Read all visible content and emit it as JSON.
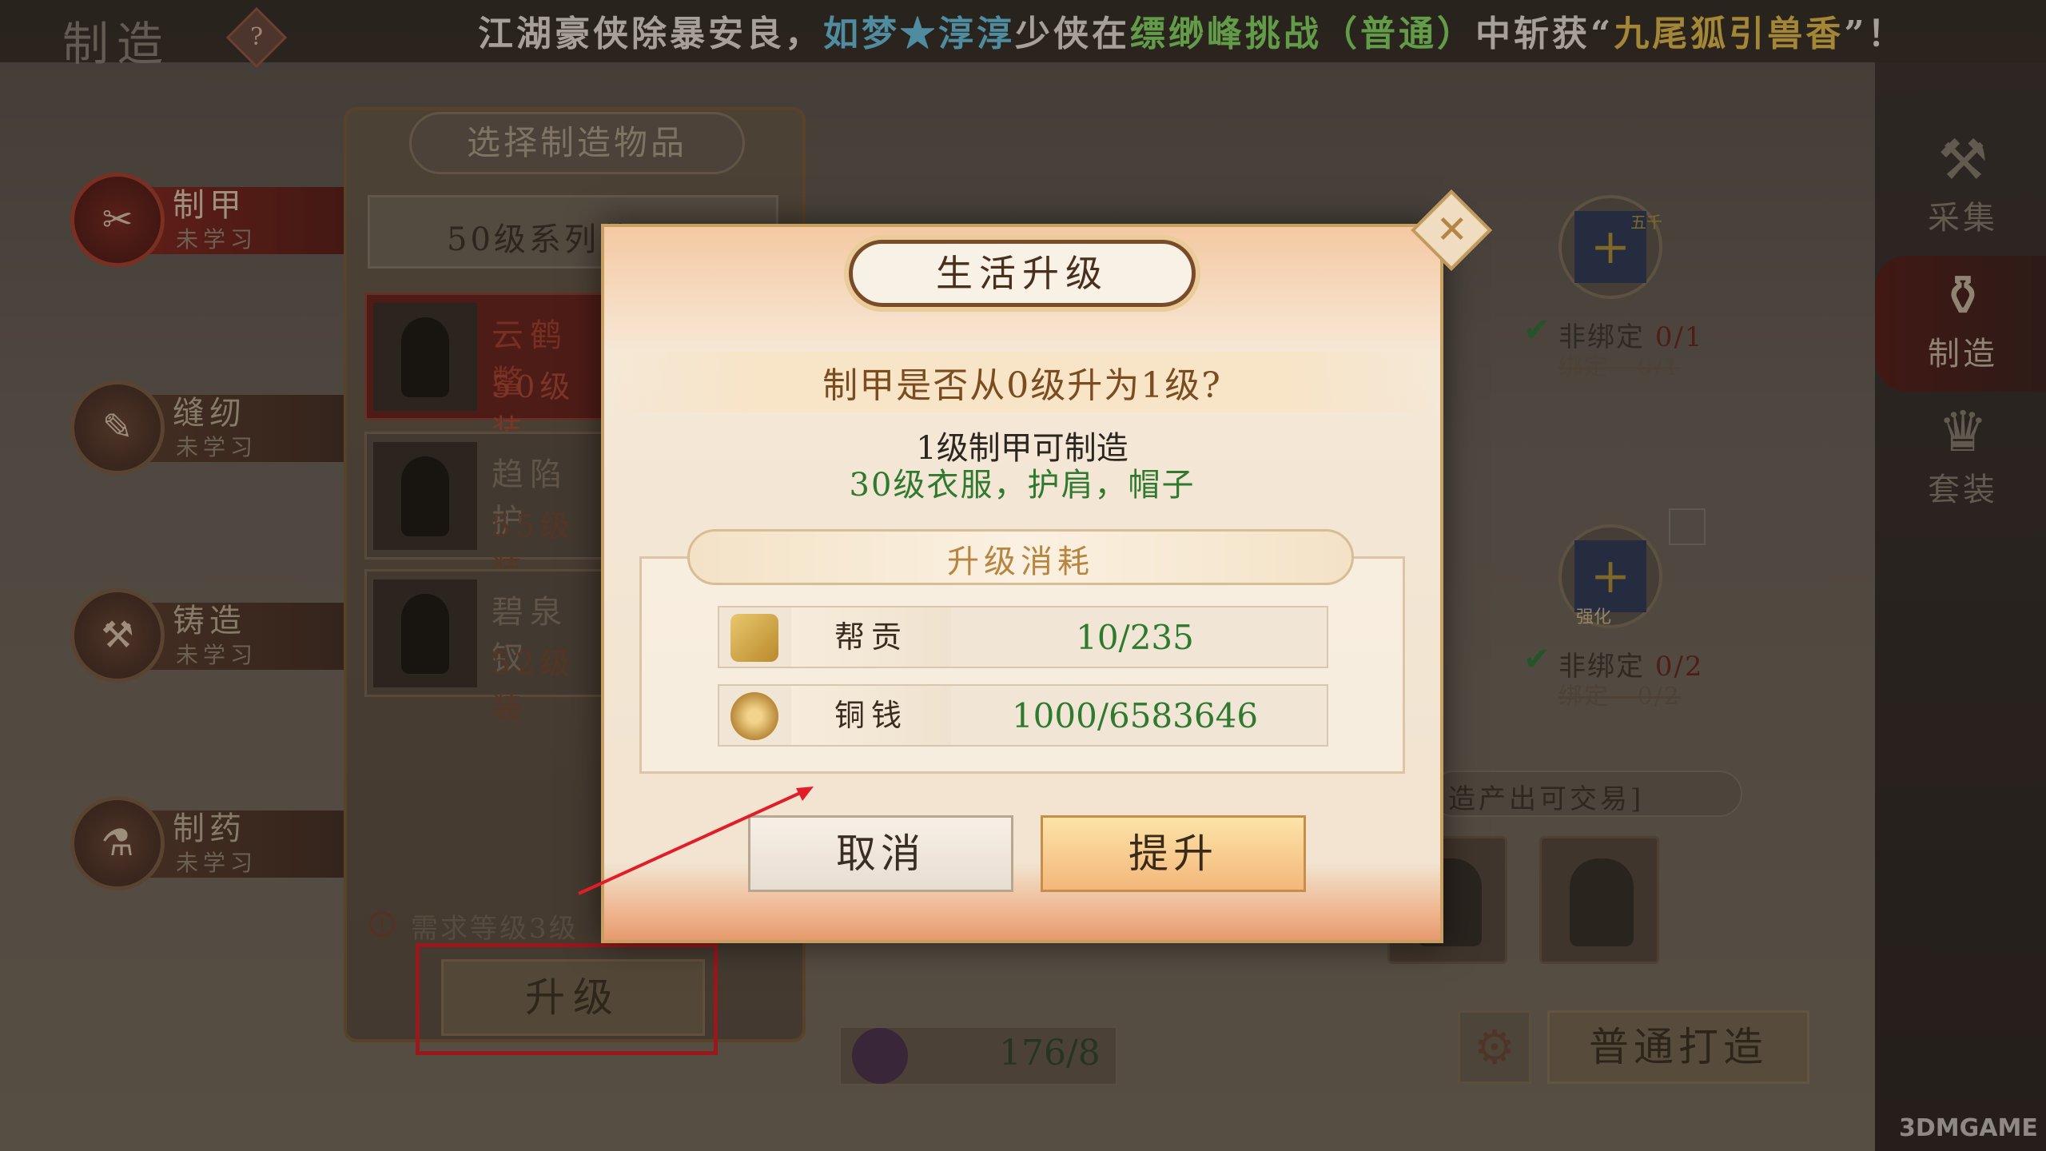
{
  "screen_title": "制造",
  "help_icon": "?",
  "broadcast": {
    "part1": "江湖豪侠除暴安良，",
    "player": "如梦★淳淳",
    "part2": "少侠在",
    "location": "缥缈峰挑战（普通）",
    "part3": "中斩获“",
    "item": "九尾狐引兽香",
    "part4": "”！"
  },
  "categories": [
    {
      "name": "制甲",
      "status": "未学习",
      "icon": "armor-icon"
    },
    {
      "name": "缝纫",
      "status": "未学习",
      "icon": "sewing-icon"
    },
    {
      "name": "铸造",
      "status": "未学习",
      "icon": "forging-icon"
    },
    {
      "name": "制药",
      "status": "未学习",
      "icon": "medicine-icon"
    }
  ],
  "panel": {
    "title": "选择制造物品",
    "series_select": "50级系列装",
    "items": [
      {
        "name": "云鹤鳖",
        "level": "50级装"
      },
      {
        "name": "趋陷护",
        "level": "55级装"
      },
      {
        "name": "碧泉钗",
        "level": "52级装"
      }
    ],
    "required_level": "需求等级3级",
    "upgrade_button": "升级"
  },
  "materials": [
    {
      "badge": "五千",
      "unbound_label": "非绑定",
      "unbound_count": "0/1",
      "bound_label": "绑定",
      "bound_count": "0/1"
    },
    {
      "badge": "强化",
      "unbound_label": "非绑定",
      "unbound_count": "0/2",
      "bound_label": "绑定",
      "bound_count": "0/2"
    }
  ],
  "tradable_note": "造产出可交易]",
  "cost_display": "176/8",
  "craft_button": "普通打造",
  "sidebar": [
    {
      "label": "采集",
      "icon": "pickaxe-icon"
    },
    {
      "label": "制造",
      "icon": "mortar-icon"
    },
    {
      "label": "套装",
      "icon": "armor-set-icon"
    }
  ],
  "watermark": "3DMGAME",
  "dialog": {
    "title": "生活升级",
    "question": "制甲是否从0级升为1级?",
    "unlock_line1": "1级制甲可制造",
    "unlock_line2": "30级衣服，护肩，帽子",
    "cost_header": "升级消耗",
    "costs": [
      {
        "label": "帮贡",
        "value": "10/235",
        "icon": "token-icon"
      },
      {
        "label": "铜钱",
        "value": "1000/6583646",
        "icon": "coin-icon"
      }
    ],
    "cancel_button": "取消",
    "confirm_button": "提升"
  },
  "colors": {
    "highlight": "#e21d27",
    "green_value": "#2f7a2e",
    "accent_gold": "#c89f63"
  }
}
